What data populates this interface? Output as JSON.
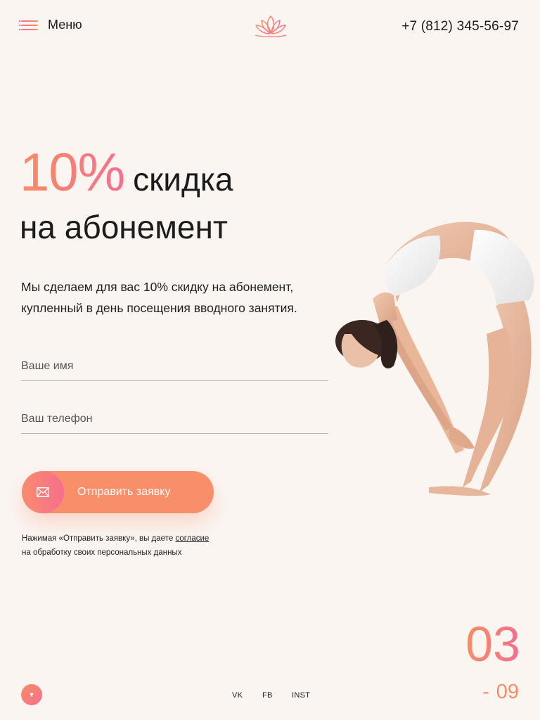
{
  "header": {
    "menu_label": "Меню",
    "phone": "+7 (812) 345-56-97"
  },
  "hero": {
    "discount": "10%",
    "title_word": "скидка",
    "title_line2": "на абонемент",
    "description": "Мы сделаем для вас 10% скидку на абонемент, купленный в день посещения вводного занятия."
  },
  "form": {
    "name_placeholder": "Ваше имя",
    "phone_placeholder": "Ваш телефон",
    "submit_label": "Отправить заявку",
    "consent_text": "Нажимая «Отправить заявку», вы даете",
    "consent_link": "согласие",
    "consent_text2": "на обработку своих персональных данных"
  },
  "slider": {
    "current": "03",
    "dash": "-",
    "total": "09"
  },
  "social": {
    "vk": "VK",
    "fb": "FB",
    "inst": "INST"
  },
  "icons": {
    "menu": "burger-menu-icon",
    "logo": "lotus-logo-icon",
    "envelope": "envelope-icon",
    "scroll": "triangle-down-icon"
  },
  "colors": {
    "accent_orange": "#f78d64",
    "accent_pink": "#f56f8e",
    "background": "#fbf5f2"
  }
}
